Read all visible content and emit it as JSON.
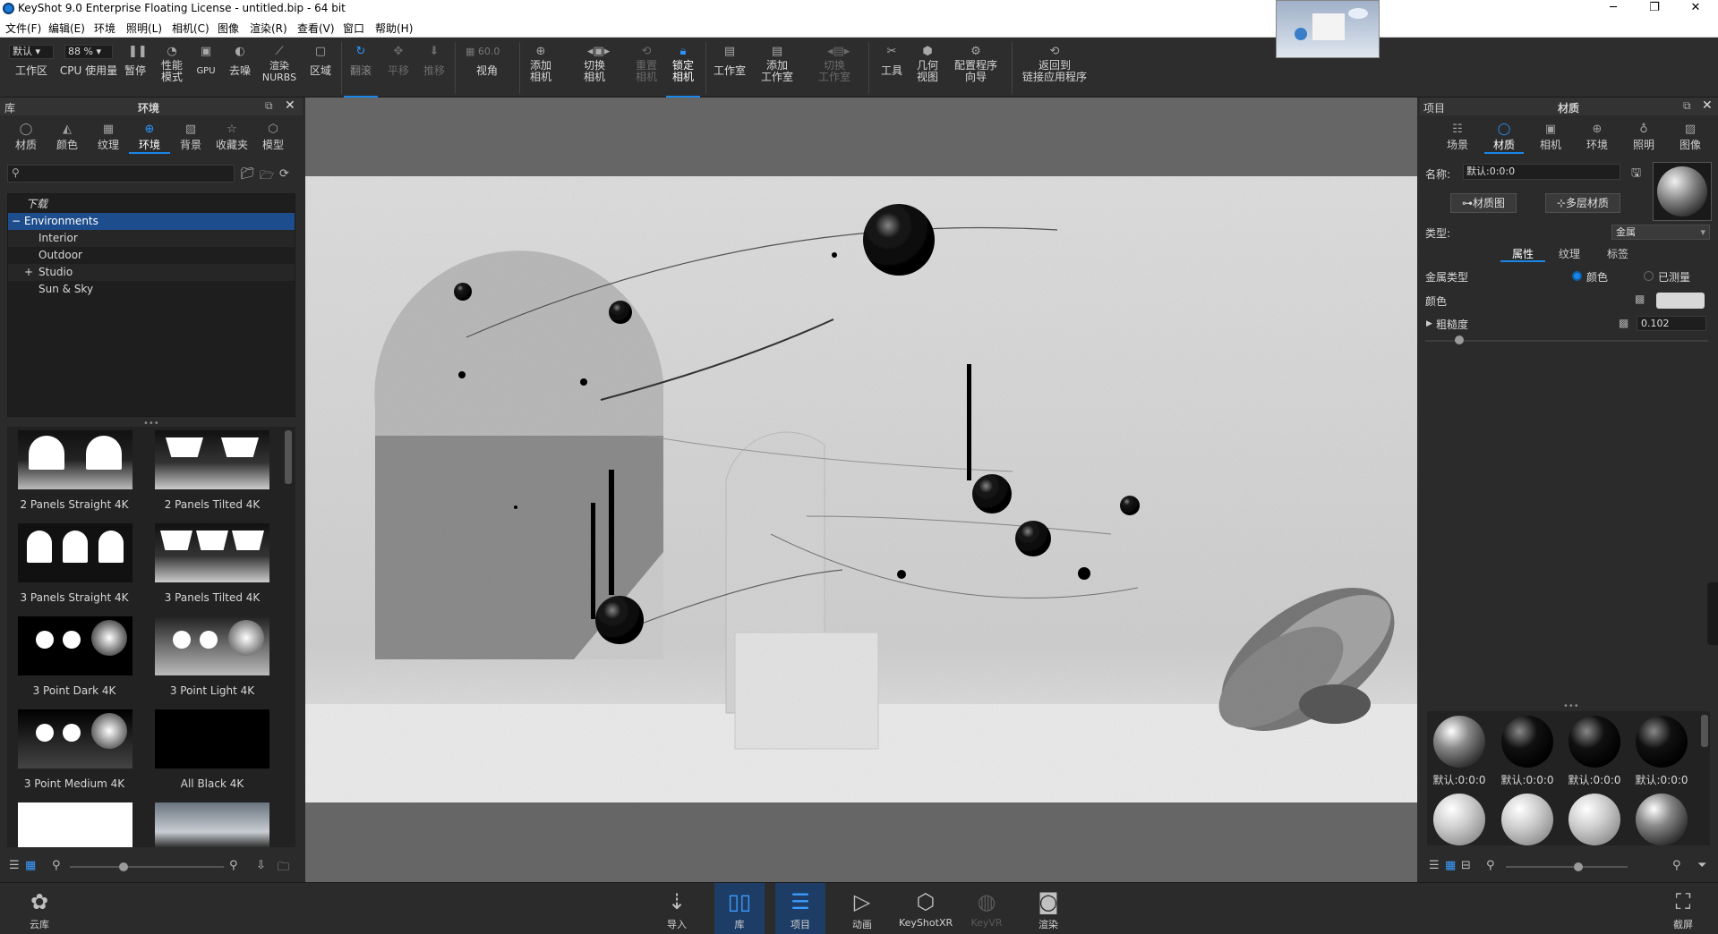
{
  "window": {
    "title": "KeyShot 9.0 Enterprise Floating License  - untitled.bip  - 64 bit",
    "minimize": "─",
    "restore": "❐",
    "close": "✕"
  },
  "menu": [
    "文件(F)",
    "编辑(E)",
    "环境",
    "照明(L)",
    "相机(C)",
    "图像",
    "渲染(R)",
    "查看(V)",
    "窗口",
    "帮助(H)"
  ],
  "toolbar": {
    "workspace_value": "默认",
    "workspace_label": "工作区",
    "cpu_value": "88 %",
    "cpu_label": "CPU 使用量",
    "pause": "暂停",
    "perf_mode": "性能\n模式",
    "gpu": "GPU",
    "denoise": "去噪",
    "render_nurbs": "渲染\nNURBS",
    "region": "区域",
    "tumble": "翻滚",
    "pan": "平移",
    "dolly": "推移",
    "fov_value": "60.0",
    "view_angle": "视角",
    "add_camera": "添加\n相机",
    "switch_camera": "切换\n相机",
    "reset_camera": "重置\n相机",
    "lock_camera": "锁定\n相机",
    "studio": "工作室",
    "add_studio": "添加\n工作室",
    "switch_studio": "切换\n工作室",
    "tools": "工具",
    "geometry_view": "几何\n视图",
    "config_wizard": "配置程序\n向导",
    "back_to_linked": "返回到\n链接应用程序"
  },
  "library": {
    "header_left": "库",
    "header_title": "环境",
    "tabs": [
      "材质",
      "颜色",
      "纹理",
      "环境",
      "背景",
      "收藏夹",
      "模型"
    ],
    "selected_tab": "环境",
    "search_placeholder": "",
    "tree": [
      "下载",
      "Environments",
      "Interior",
      "Outdoor",
      "Studio",
      "Sun & Sky"
    ],
    "tree_toggle_minus": "−",
    "tree_toggle_plus": "+",
    "thumbs": [
      "2 Panels Straight 4K",
      "2 Panels Tilted 4K",
      "3 Panels Straight 4K",
      "3 Panels Tilted 4K",
      "3 Point Dark 4K",
      "3 Point Light 4K",
      "3 Point Medium 4K",
      "All Black 4K"
    ]
  },
  "project": {
    "header_left": "项目",
    "header_title": "材质",
    "tabs": [
      "场景",
      "材质",
      "相机",
      "环境",
      "照明",
      "图像"
    ],
    "selected_tab": "材质",
    "name_label": "名称:",
    "name_value": "默认:0:0:0",
    "material_graph": "材质图",
    "multi_layer": "多层材质",
    "type_label": "类型:",
    "type_value": "金属",
    "subtabs": [
      "属性",
      "纹理",
      "标签"
    ],
    "metal_type_label": "金属类型",
    "radio_color": "颜色",
    "radio_measured": "已测量",
    "color_label": "颜色",
    "roughness_label": "粗糙度",
    "roughness_value": "0.102",
    "roughness": 0.102,
    "material_balls": [
      "默认:0:0:0",
      "默认:0:0:0",
      "默认:0:0:0",
      "默认:0:0:0"
    ]
  },
  "bottom": {
    "cloud_library": "云库",
    "import": "导入",
    "library": "库",
    "project": "项目",
    "animation": "动画",
    "keyshotxr": "KeyShotXR",
    "keyvr": "KeyVR",
    "render": "渲染",
    "screenshot": "截屏"
  },
  "colors": {
    "accent": "#1a86e8",
    "selected_row": "#1d4d8c",
    "panel_bg": "#2b2b2b",
    "viewport_bg": "#666666"
  }
}
